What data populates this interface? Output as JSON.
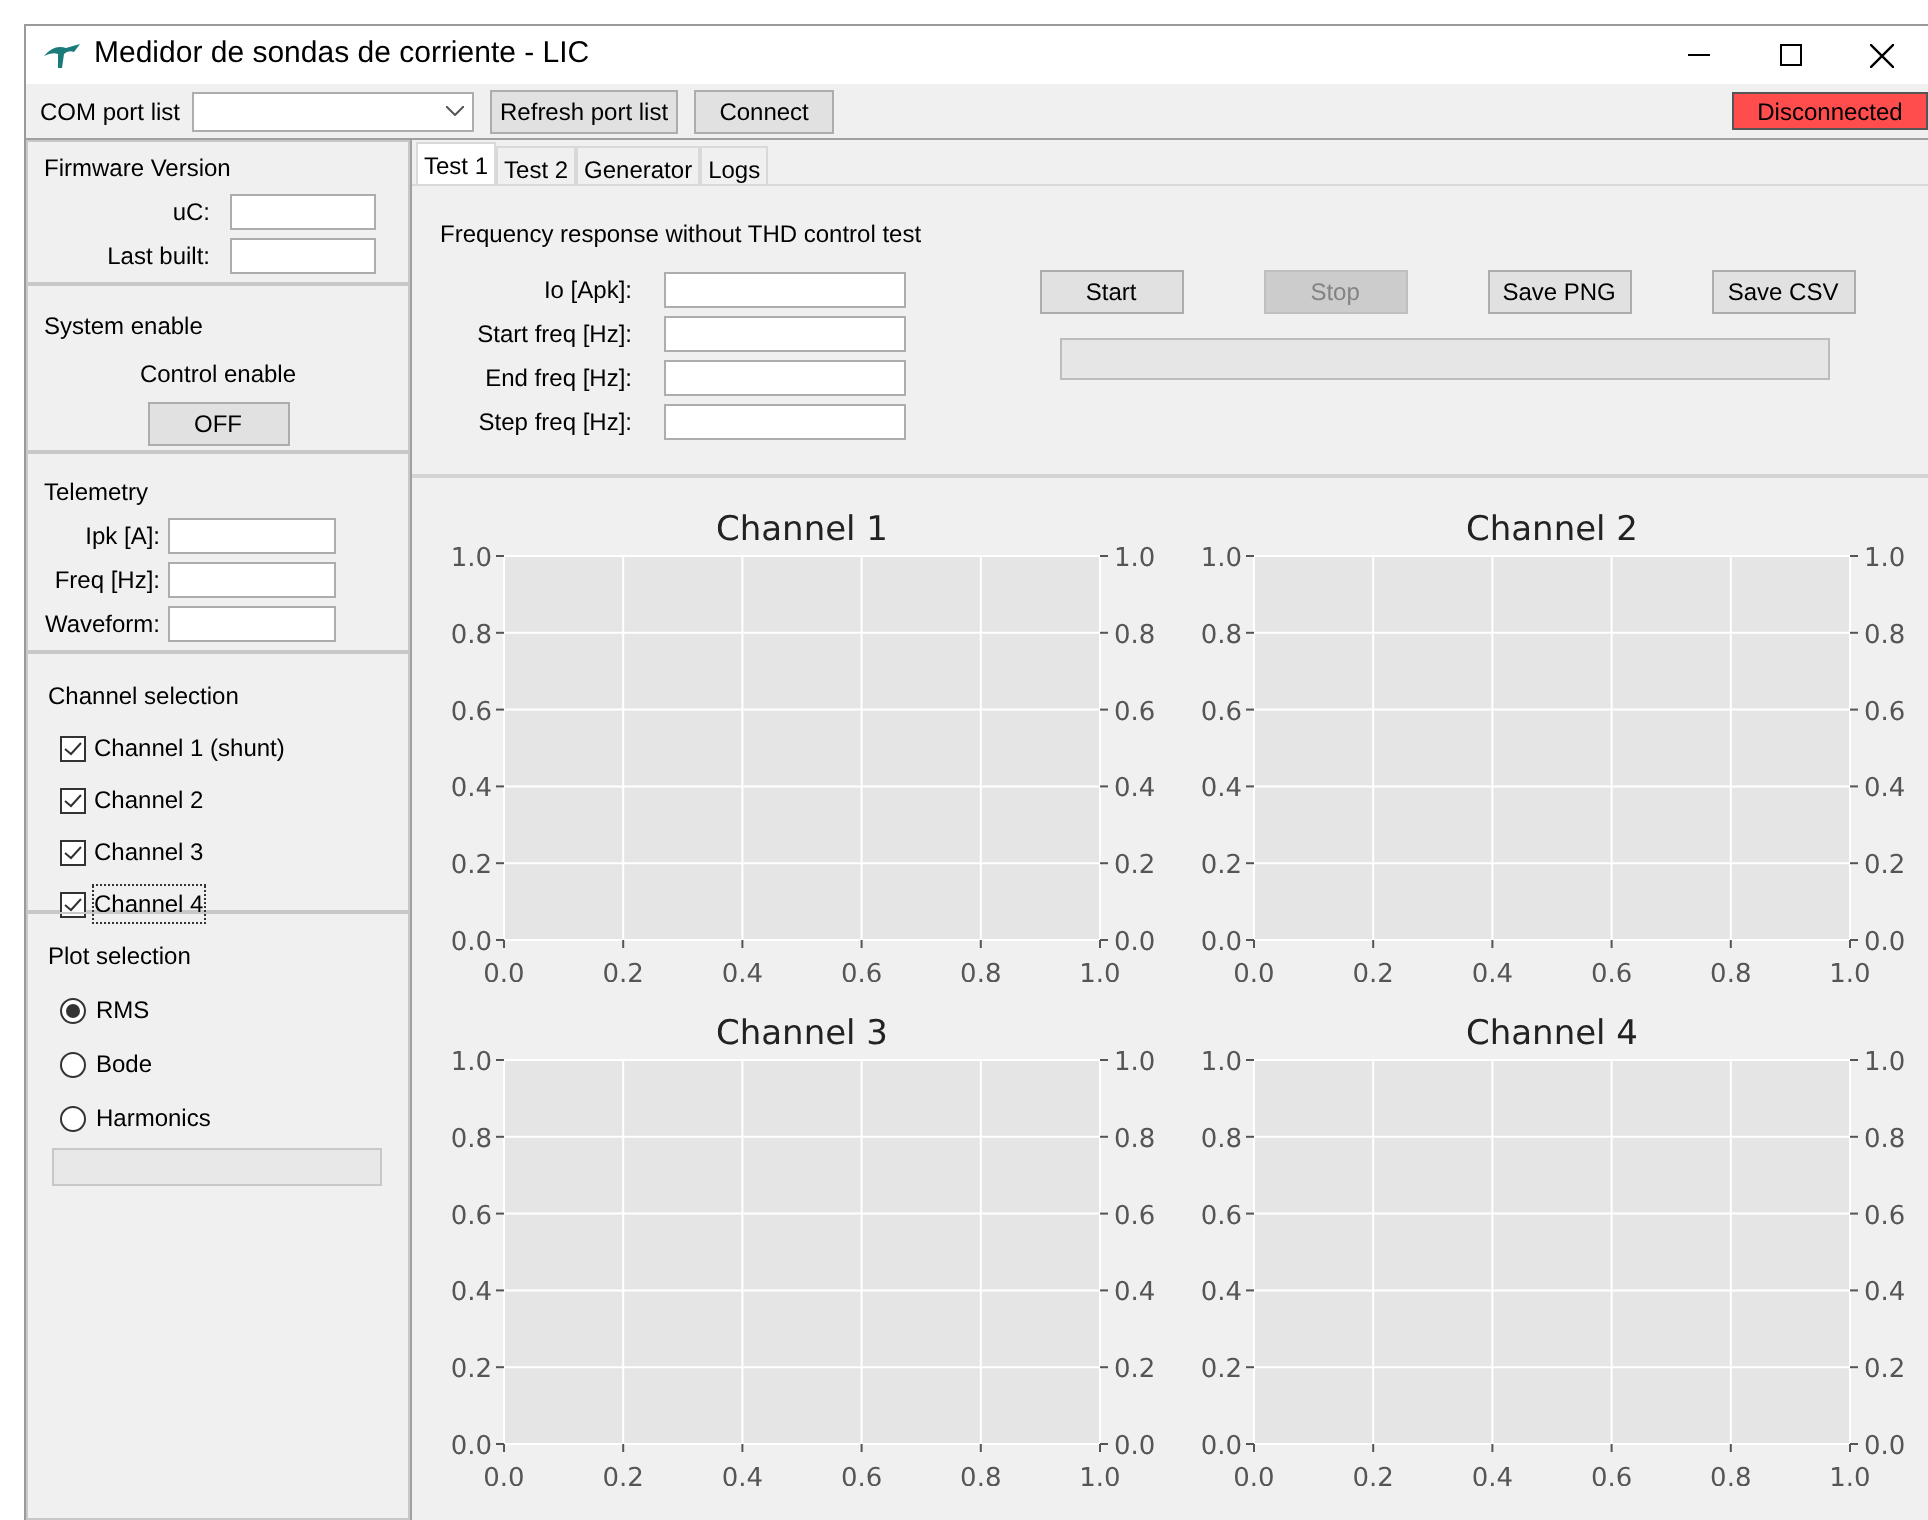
{
  "window": {
    "title": "Medidor de sondas de corriente - LIC"
  },
  "toolbar": {
    "com_port_label": "COM port list",
    "buttons": [
      "Refresh port list",
      "Connect"
    ],
    "status": {
      "text": "Disconnected",
      "connected": false
    }
  },
  "sidebar": {
    "firmware": {
      "title": "Firmware Version",
      "fields": [
        {
          "label": "uC:"
        },
        {
          "label": "Last built:"
        }
      ]
    },
    "system_enable": {
      "title": "System enable",
      "label": "Control enable",
      "toggle": {
        "text": "OFF",
        "on": false
      }
    },
    "telemetry": {
      "title": "Telemetry",
      "fields": [
        {
          "label": "Ipk [A]:"
        },
        {
          "label": "Freq [Hz]:"
        },
        {
          "label": "Waveform:"
        }
      ]
    },
    "channel_selection": {
      "title": "Channel selection",
      "items": [
        {
          "label": "Channel 1 (shunt)",
          "checked": true,
          "focused": false
        },
        {
          "label": "Channel 2",
          "checked": true,
          "focused": false
        },
        {
          "label": "Channel 3",
          "checked": true,
          "focused": false
        },
        {
          "label": "Channel 4",
          "checked": true,
          "focused": true
        }
      ]
    },
    "plot_selection": {
      "title": "Plot selection",
      "items": [
        {
          "label": "RMS",
          "selected": true
        },
        {
          "label": "Bode",
          "selected": false
        },
        {
          "label": "Harmonics",
          "selected": false
        }
      ]
    }
  },
  "tabs": [
    {
      "label": "Test 1",
      "selected": true
    },
    {
      "label": "Test 2",
      "selected": false
    },
    {
      "label": "Generator",
      "selected": false
    },
    {
      "label": "Logs",
      "selected": false
    }
  ],
  "test": {
    "title": "Frequency response without THD control test",
    "fields": [
      {
        "label": "Io [Apk]:"
      },
      {
        "label": "Start freq [Hz]:"
      },
      {
        "label": "End freq [Hz]:"
      },
      {
        "label": "Step freq [Hz]:"
      }
    ],
    "buttons": [
      {
        "label": "Start",
        "disabled": false
      },
      {
        "label": "Stop",
        "disabled": true
      },
      {
        "label": "Save PNG",
        "disabled": false
      },
      {
        "label": "Save CSV",
        "disabled": false
      }
    ],
    "progress": {
      "level": 0
    }
  },
  "charts": [
    {
      "chart_data": {
        "type": "line",
        "grid": true,
        "title": "Channel 1",
        "xlim": [
          0,
          1
        ],
        "ylim": [
          0,
          1
        ],
        "xticks": [
          {
            "value": 0,
            "label": "0.0"
          },
          {
            "value": 0.2,
            "label": "0.2"
          },
          {
            "value": 0.4,
            "label": "0.4"
          },
          {
            "value": 0.6,
            "label": "0.6"
          },
          {
            "value": 0.8,
            "label": "0.8"
          },
          {
            "value": 1,
            "label": "1.0"
          }
        ],
        "yticks": [
          {
            "value": 0,
            "label": "0.0"
          },
          {
            "value": 0.2,
            "label": "0.2"
          },
          {
            "value": 0.4,
            "label": "0.4"
          },
          {
            "value": 0.6,
            "label": "0.6"
          },
          {
            "value": 0.8,
            "label": "0.8"
          },
          {
            "value": 1,
            "label": "1.0"
          }
        ]
      }
    },
    {
      "chart_data": {
        "type": "line",
        "grid": true,
        "title": "Channel 2",
        "xlim": [
          0,
          1
        ],
        "ylim": [
          0,
          1
        ],
        "xticks": [
          {
            "value": 0,
            "label": "0.0"
          },
          {
            "value": 0.2,
            "label": "0.2"
          },
          {
            "value": 0.4,
            "label": "0.4"
          },
          {
            "value": 0.6,
            "label": "0.6"
          },
          {
            "value": 0.8,
            "label": "0.8"
          },
          {
            "value": 1,
            "label": "1.0"
          }
        ],
        "yticks": [
          {
            "value": 0,
            "label": "0.0"
          },
          {
            "value": 0.2,
            "label": "0.2"
          },
          {
            "value": 0.4,
            "label": "0.4"
          },
          {
            "value": 0.6,
            "label": "0.6"
          },
          {
            "value": 0.8,
            "label": "0.8"
          },
          {
            "value": 1,
            "label": "1.0"
          }
        ]
      }
    },
    {
      "chart_data": {
        "type": "line",
        "grid": true,
        "title": "Channel 3",
        "xlim": [
          0,
          1
        ],
        "ylim": [
          0,
          1
        ],
        "xticks": [
          {
            "value": 0,
            "label": "0.0"
          },
          {
            "value": 0.2,
            "label": "0.2"
          },
          {
            "value": 0.4,
            "label": "0.4"
          },
          {
            "value": 0.6,
            "label": "0.6"
          },
          {
            "value": 0.8,
            "label": "0.8"
          },
          {
            "value": 1,
            "label": "1.0"
          }
        ],
        "yticks": [
          {
            "value": 0,
            "label": "0.0"
          },
          {
            "value": 0.2,
            "label": "0.2"
          },
          {
            "value": 0.4,
            "label": "0.4"
          },
          {
            "value": 0.6,
            "label": "0.6"
          },
          {
            "value": 0.8,
            "label": "0.8"
          },
          {
            "value": 1,
            "label": "1.0"
          }
        ]
      }
    },
    {
      "chart_data": {
        "type": "line",
        "grid": true,
        "title": "Channel 4",
        "xlim": [
          0,
          1
        ],
        "ylim": [
          0,
          1
        ],
        "xticks": [
          {
            "value": 0,
            "label": "0.0"
          },
          {
            "value": 0.2,
            "label": "0.2"
          },
          {
            "value": 0.4,
            "label": "0.4"
          },
          {
            "value": 0.6,
            "label": "0.6"
          },
          {
            "value": 0.8,
            "label": "0.8"
          },
          {
            "value": 1,
            "label": "1.0"
          }
        ],
        "yticks": [
          {
            "value": 0,
            "label": "0.0"
          },
          {
            "value": 0.2,
            "label": "0.2"
          },
          {
            "value": 0.4,
            "label": "0.4"
          },
          {
            "value": 0.6,
            "label": "0.6"
          },
          {
            "value": 0.8,
            "label": "0.8"
          },
          {
            "value": 1,
            "label": "1.0"
          }
        ]
      }
    }
  ]
}
